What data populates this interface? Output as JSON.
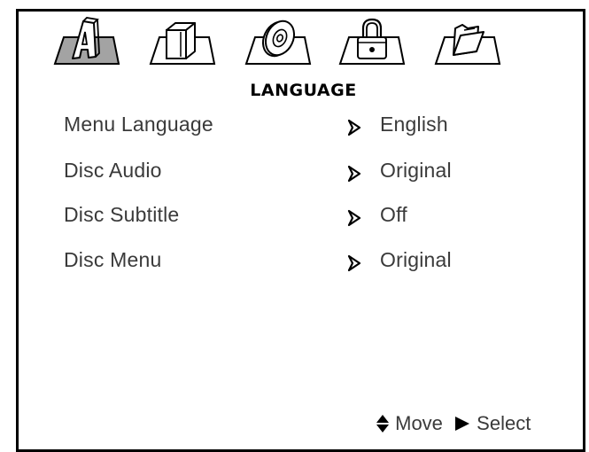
{
  "screen": {
    "title": "LANGUAGE"
  },
  "tabs": [
    {
      "icon": "language-letter-a-icon",
      "selected": true
    },
    {
      "icon": "box-icon",
      "selected": false
    },
    {
      "icon": "disc-icon",
      "selected": false
    },
    {
      "icon": "padlock-icon",
      "selected": false
    },
    {
      "icon": "folder-icon",
      "selected": false
    }
  ],
  "settings": [
    {
      "label": "Menu Language",
      "value": "English"
    },
    {
      "label": "Disc Audio",
      "value": "Original"
    },
    {
      "label": "Disc Subtitle",
      "value": "Off"
    },
    {
      "label": "Disc Menu",
      "value": "Original"
    }
  ],
  "hints": {
    "move_icon": "up-down-diamond-icon",
    "move_label": "Move",
    "select_icon": "play-triangle-icon",
    "select_label": "Select"
  },
  "colors": {
    "selected_tab_fill": "#a3a3a3",
    "text": "#3a3a3a",
    "border": "#000000"
  }
}
